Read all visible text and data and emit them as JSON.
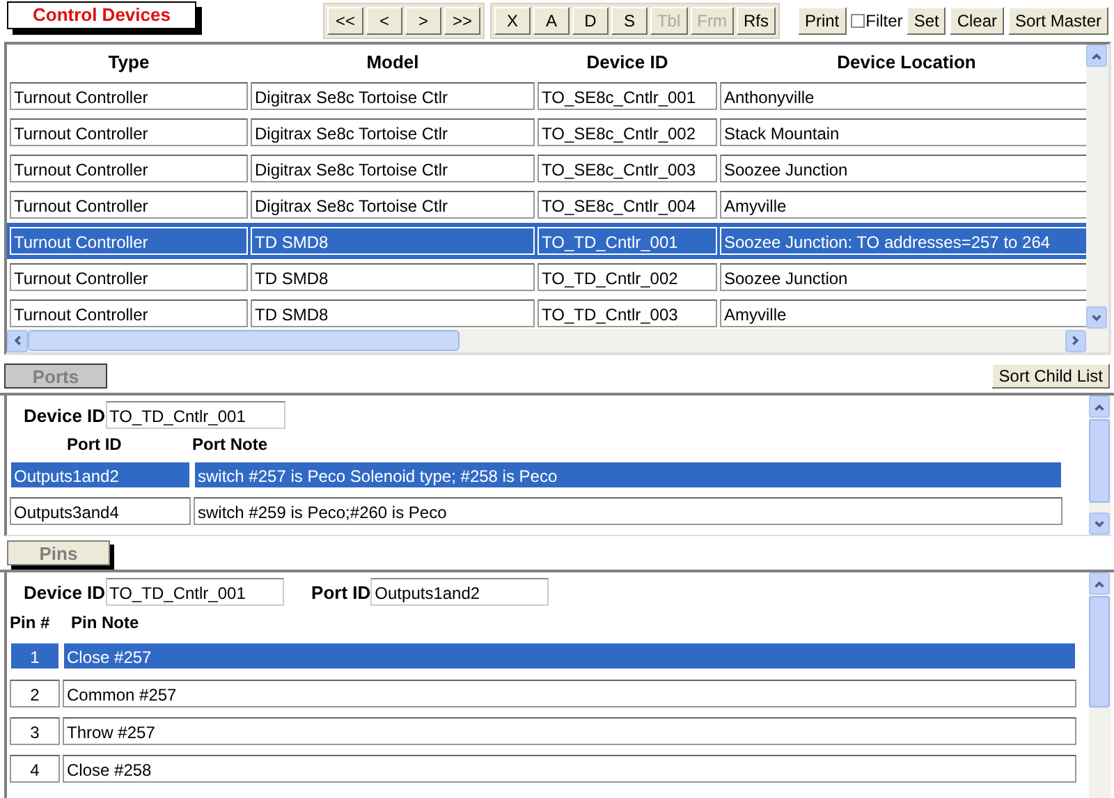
{
  "title": "Control Devices",
  "nav_buttons": [
    {
      "label": "<<",
      "disabled": false
    },
    {
      "label": "<",
      "disabled": false
    },
    {
      "label": ">",
      "disabled": false
    },
    {
      "label": ">>",
      "disabled": false
    }
  ],
  "action_buttons": [
    {
      "label": "X",
      "disabled": false
    },
    {
      "label": "A",
      "disabled": false
    },
    {
      "label": "D",
      "disabled": false
    },
    {
      "label": "S",
      "disabled": false
    },
    {
      "label": "Tbl",
      "disabled": true
    },
    {
      "label": "Frm",
      "disabled": true
    },
    {
      "label": "Rfs",
      "disabled": false
    }
  ],
  "print_button": "Print",
  "filter": {
    "label": "Filter",
    "checked": false
  },
  "set_button": "Set",
  "clear_button": "Clear",
  "sort_master_button": "Sort Master",
  "devices": {
    "columns": [
      "Type",
      "Model",
      "Device ID",
      "Device Location"
    ],
    "rows": [
      {
        "cells": [
          "Turnout Controller",
          "Digitrax Se8c Tortoise Ctlr",
          "TO_SE8c_Cntlr_001",
          "Anthonyville"
        ],
        "selected": false
      },
      {
        "cells": [
          "Turnout Controller",
          "Digitrax Se8c Tortoise Ctlr",
          "TO_SE8c_Cntlr_002",
          "Stack Mountain"
        ],
        "selected": false
      },
      {
        "cells": [
          "Turnout Controller",
          "Digitrax Se8c Tortoise Ctlr",
          "TO_SE8c_Cntlr_003",
          "Soozee Junction"
        ],
        "selected": false
      },
      {
        "cells": [
          "Turnout Controller",
          "Digitrax Se8c Tortoise Ctlr",
          "TO_SE8c_Cntlr_004",
          "Amyville"
        ],
        "selected": false
      },
      {
        "cells": [
          "Turnout Controller",
          "TD SMD8",
          "TO_TD_Cntlr_001",
          "Soozee Junction: TO addresses=257 to 264"
        ],
        "selected": true
      },
      {
        "cells": [
          "Turnout Controller",
          "TD SMD8",
          "TO_TD_Cntlr_002",
          "Soozee Junction"
        ],
        "selected": false
      },
      {
        "cells": [
          "Turnout Controller",
          "TD SMD8",
          "TO_TD_Cntlr_003",
          "Amyville"
        ],
        "selected": false
      }
    ]
  },
  "ports": {
    "tab": "Ports",
    "sort_button": "Sort Child List",
    "device_id_label": "Device ID",
    "device_id": "TO_TD_Cntlr_001",
    "columns": [
      "Port ID",
      "Port Note"
    ],
    "rows": [
      {
        "port_id": "Outputs1and2",
        "note": "switch #257 is Peco Solenoid type; #258 is Peco",
        "selected": true
      },
      {
        "port_id": "Outputs3and4",
        "note": "switch #259 is Peco;#260 is Peco",
        "selected": false
      }
    ]
  },
  "pins": {
    "tab": "Pins",
    "device_id_label": "Device ID",
    "device_id": "TO_TD_Cntlr_001",
    "port_id_label": "Port ID",
    "port_id": "Outputs1and2",
    "columns": [
      "Pin #",
      "Pin Note"
    ],
    "rows": [
      {
        "pin": "1",
        "note": "Close #257",
        "selected": true
      },
      {
        "pin": "2",
        "note": "Common #257",
        "selected": false
      },
      {
        "pin": "3",
        "note": "Throw #257",
        "selected": false
      },
      {
        "pin": "4",
        "note": "Close #258",
        "selected": false
      }
    ]
  }
}
